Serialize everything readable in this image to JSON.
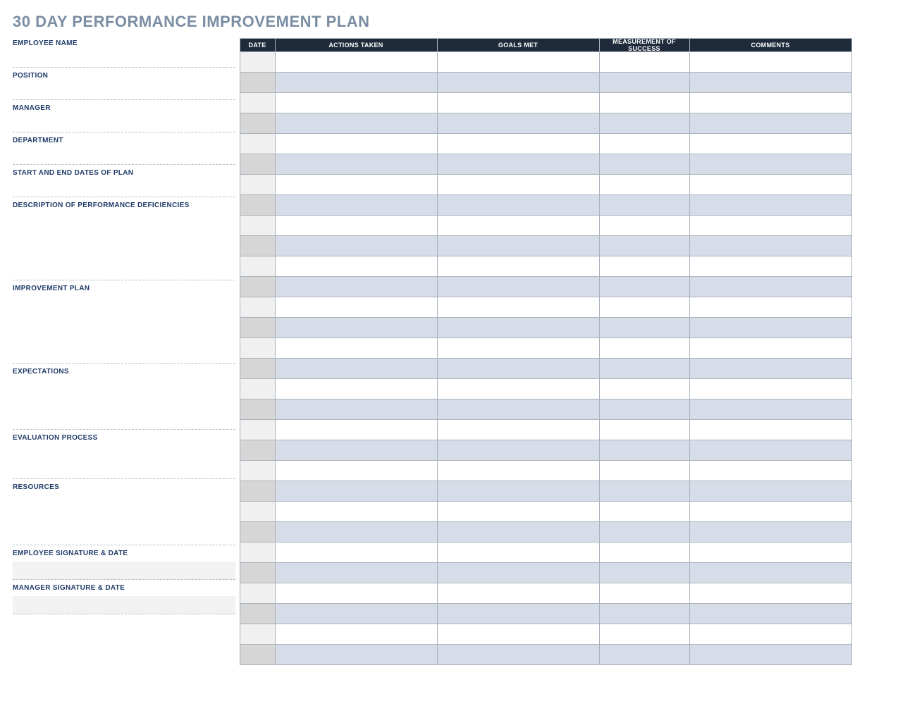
{
  "title": "30 DAY PERFORMANCE IMPROVEMENT PLAN",
  "leftFields": [
    {
      "label": "EMPLOYEE NAME",
      "inputRows": 1,
      "signature": false
    },
    {
      "label": "POSITION",
      "inputRows": 1,
      "signature": false
    },
    {
      "label": "MANAGER",
      "inputRows": 1,
      "signature": false
    },
    {
      "label": "DEPARTMENT",
      "inputRows": 1,
      "signature": false
    },
    {
      "label": "START AND END DATES OF PLAN",
      "inputRows": 1,
      "signature": false
    },
    {
      "label": "DESCRIPTION OF PERFORMANCE DEFICIENCIES",
      "inputRows": 4,
      "signature": false
    },
    {
      "label": "IMPROVEMENT PLAN",
      "inputRows": 4,
      "signature": false
    },
    {
      "label": "EXPECTATIONS",
      "inputRows": 3,
      "signature": false
    },
    {
      "label": "EVALUATION PROCESS",
      "inputRows": 2,
      "signature": false
    },
    {
      "label": "RESOURCES",
      "inputRows": 3,
      "signature": false
    },
    {
      "label": "EMPLOYEE SIGNATURE & DATE",
      "inputRows": 0,
      "signature": true
    },
    {
      "label": "MANAGER SIGNATURE & DATE",
      "inputRows": 0,
      "signature": true
    }
  ],
  "gridHeaders": [
    "DATE",
    "ACTIONS TAKEN",
    "GOALS MET",
    "MEASUREMENT OF SUCCESS",
    "COMMENTS"
  ],
  "gridRowCount": 30,
  "gridRows": [
    [
      "",
      "",
      "",
      "",
      ""
    ],
    [
      "",
      "",
      "",
      "",
      ""
    ],
    [
      "",
      "",
      "",
      "",
      ""
    ],
    [
      "",
      "",
      "",
      "",
      ""
    ],
    [
      "",
      "",
      "",
      "",
      ""
    ],
    [
      "",
      "",
      "",
      "",
      ""
    ],
    [
      "",
      "",
      "",
      "",
      ""
    ],
    [
      "",
      "",
      "",
      "",
      ""
    ],
    [
      "",
      "",
      "",
      "",
      ""
    ],
    [
      "",
      "",
      "",
      "",
      ""
    ],
    [
      "",
      "",
      "",
      "",
      ""
    ],
    [
      "",
      "",
      "",
      "",
      ""
    ],
    [
      "",
      "",
      "",
      "",
      ""
    ],
    [
      "",
      "",
      "",
      "",
      ""
    ],
    [
      "",
      "",
      "",
      "",
      ""
    ],
    [
      "",
      "",
      "",
      "",
      ""
    ],
    [
      "",
      "",
      "",
      "",
      ""
    ],
    [
      "",
      "",
      "",
      "",
      ""
    ],
    [
      "",
      "",
      "",
      "",
      ""
    ],
    [
      "",
      "",
      "",
      "",
      ""
    ],
    [
      "",
      "",
      "",
      "",
      ""
    ],
    [
      "",
      "",
      "",
      "",
      ""
    ],
    [
      "",
      "",
      "",
      "",
      ""
    ],
    [
      "",
      "",
      "",
      "",
      ""
    ],
    [
      "",
      "",
      "",
      "",
      ""
    ],
    [
      "",
      "",
      "",
      "",
      ""
    ],
    [
      "",
      "",
      "",
      "",
      ""
    ],
    [
      "",
      "",
      "",
      "",
      ""
    ],
    [
      "",
      "",
      "",
      "",
      ""
    ],
    [
      "",
      "",
      "",
      "",
      ""
    ]
  ]
}
